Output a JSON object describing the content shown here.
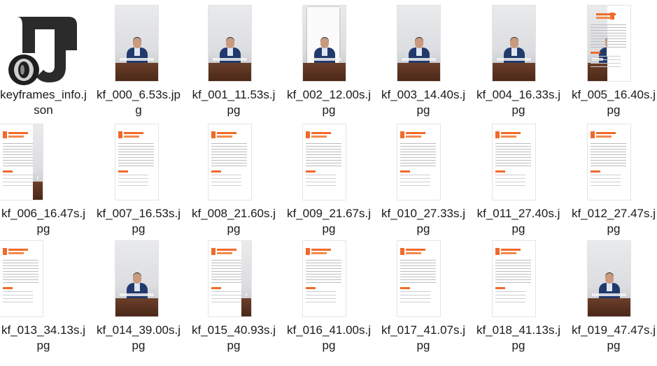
{
  "files": [
    {
      "name": "keyframes_info.json",
      "kind": "json"
    },
    {
      "name": "kf_000_6.53s.jpg",
      "kind": "photo"
    },
    {
      "name": "kf_001_11.53s.jpg",
      "kind": "photo"
    },
    {
      "name": "kf_002_12.00s.jpg",
      "kind": "paper"
    },
    {
      "name": "kf_003_14.40s.jpg",
      "kind": "photo"
    },
    {
      "name": "kf_004_16.33s.jpg",
      "kind": "photo"
    },
    {
      "name": "kf_005_16.40s.jpg",
      "kind": "photodoc"
    },
    {
      "name": "kf_006_16.47s.jpg",
      "kind": "docphoto"
    },
    {
      "name": "kf_007_16.53s.jpg",
      "kind": "doc"
    },
    {
      "name": "kf_008_21.60s.jpg",
      "kind": "doc"
    },
    {
      "name": "kf_009_21.67s.jpg",
      "kind": "doc"
    },
    {
      "name": "kf_010_27.33s.jpg",
      "kind": "doc"
    },
    {
      "name": "kf_011_27.40s.jpg",
      "kind": "doc"
    },
    {
      "name": "kf_012_27.47s.jpg",
      "kind": "doc"
    },
    {
      "name": "kf_013_34.13s.jpg",
      "kind": "doc"
    },
    {
      "name": "kf_014_39.00s.jpg",
      "kind": "photo"
    },
    {
      "name": "kf_015_40.93s.jpg",
      "kind": "docphoto"
    },
    {
      "name": "kf_016_41.00s.jpg",
      "kind": "doc"
    },
    {
      "name": "kf_017_41.07s.jpg",
      "kind": "doc"
    },
    {
      "name": "kf_018_41.13s.jpg",
      "kind": "doc"
    },
    {
      "name": "kf_019_47.47s.jpg",
      "kind": "photo"
    }
  ],
  "colors": {
    "accent": "#f06a2a",
    "suit": "#223a6b",
    "table": "#5a3220"
  }
}
